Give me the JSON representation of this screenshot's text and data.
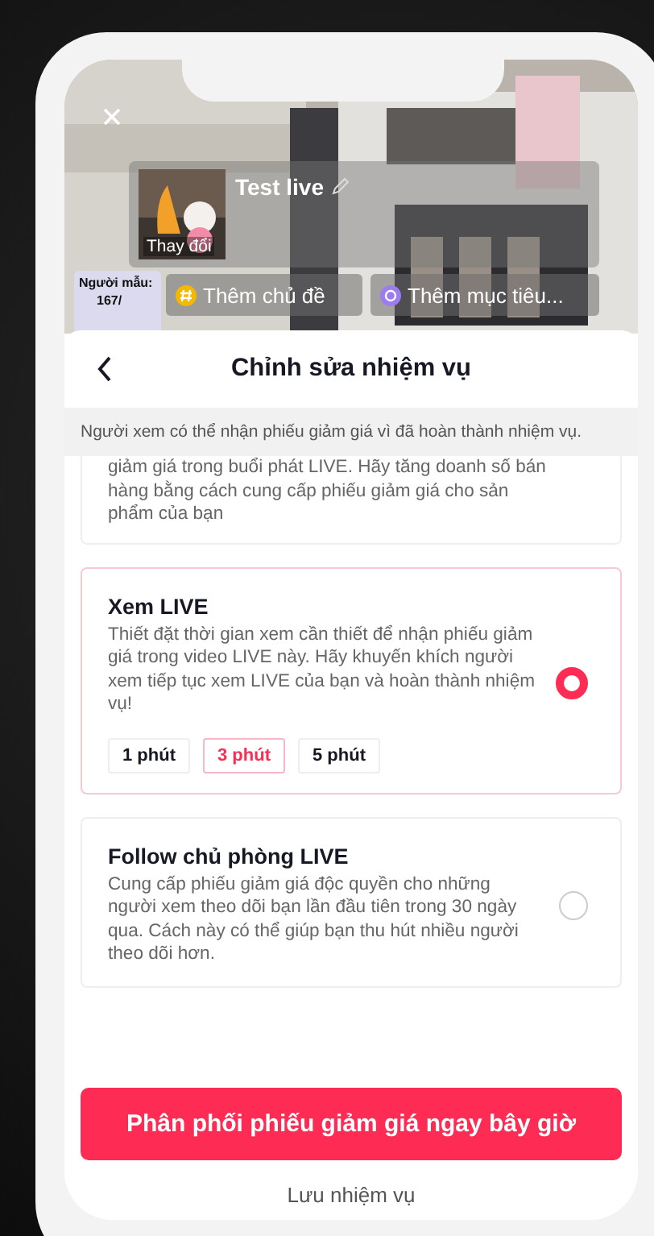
{
  "live_preview": {
    "kind": "picture",
    "title": "Test live",
    "cover_label": "Thay đổi",
    "model_label": "Người mẫu:",
    "model_value": "167/",
    "chips": [
      "Thêm chủ đề",
      "Thêm mục tiêu..."
    ]
  },
  "sheet": {
    "title": "Chỉnh sửa nhiệm vụ",
    "notice": "Người xem có thể nhận phiếu giảm giá vì đã hoàn thành nhiệm vụ.",
    "tasks": [
      {
        "kind": "partial",
        "description": "giảm giá trong buổi phát LIVE. Hãy tăng doanh số bán hàng bằng cách cung cấp phiếu giảm giá cho sản phẩm của bạn"
      },
      {
        "kind": "full",
        "title": "Xem LIVE",
        "description": "Thiết đặt thời gian xem cần thiết để nhận phiếu giảm giá trong video LIVE này. Hãy khuyến khích người xem tiếp tục xem LIVE của bạn và hoàn thành nhiệm vụ!",
        "selected": true,
        "durations": [
          {
            "label": "1 phút",
            "selected": false
          },
          {
            "label": "3 phút",
            "selected": true
          },
          {
            "label": "5 phút",
            "selected": false
          }
        ]
      },
      {
        "kind": "full",
        "title": "Follow chủ phòng LIVE",
        "description": "Cung cấp phiếu giảm giá độc quyền cho những người xem theo dõi bạn lần đầu tiên trong 30 ngày qua. Cách này có thể giúp bạn thu hút nhiều người theo dõi hơn.",
        "selected": false
      }
    ],
    "primary_button": "Phân phối phiếu giảm giá ngay bây giờ",
    "secondary_button": "Lưu nhiệm vụ"
  }
}
